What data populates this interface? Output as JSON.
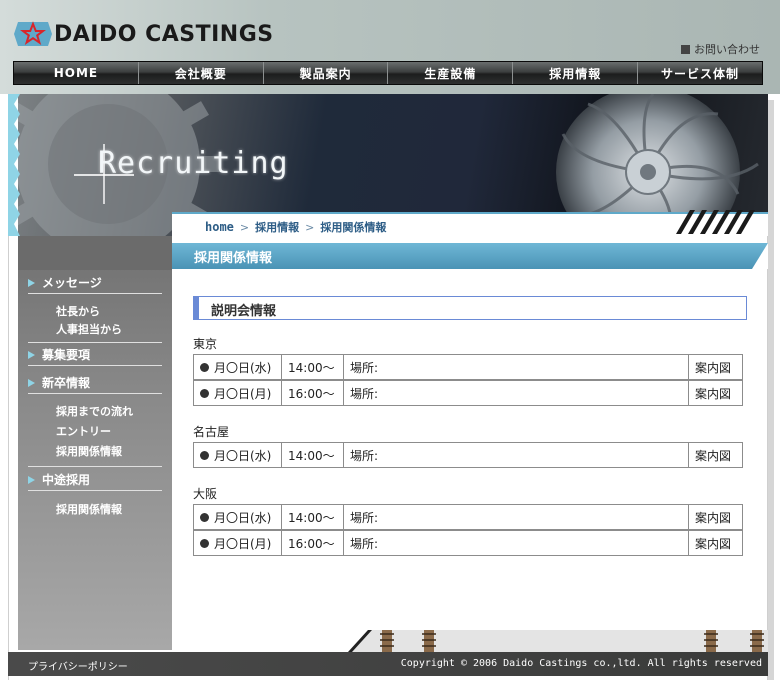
{
  "brand": {
    "name": "DAIDO CASTINGS"
  },
  "header": {
    "contact_label": "お問い合わせ"
  },
  "nav": [
    "HOME",
    "会社概要",
    "製品案内",
    "生産設備",
    "採用情報",
    "サービス体制"
  ],
  "hero": {
    "title": "Recruiting"
  },
  "breadcrumb": {
    "home": "home",
    "level1": "採用情報",
    "level2": "採用関係情報",
    "sep": ">"
  },
  "sidebar": {
    "sec1": "メッセージ",
    "sec1_items": [
      "社長から",
      "人事担当から"
    ],
    "sec2": "募集要項",
    "sec3": "新卒情報",
    "sec3_items": [
      "採用までの流れ",
      "エントリー",
      "採用関係情報"
    ],
    "sec4": "中途採用",
    "sec4_items": [
      "採用関係情報"
    ]
  },
  "page": {
    "title": "採用関係情報",
    "section": "説明会情報"
  },
  "regions": [
    {
      "name": "東京",
      "rows": [
        {
          "date": "月〇日(水)",
          "time": "14:00〜",
          "place": "場所:",
          "map": "案内図"
        },
        {
          "date": "月〇日(月)",
          "time": "16:00〜",
          "place": "場所:",
          "map": "案内図"
        }
      ]
    },
    {
      "name": "名古屋",
      "rows": [
        {
          "date": "月〇日(水)",
          "time": "14:00〜",
          "place": "場所:",
          "map": "案内図"
        }
      ]
    },
    {
      "name": "大阪",
      "rows": [
        {
          "date": "月〇日(水)",
          "time": "14:00〜",
          "place": "場所:",
          "map": "案内図"
        },
        {
          "date": "月〇日(月)",
          "time": "16:00〜",
          "place": "場所:",
          "map": "案内図"
        }
      ]
    }
  ],
  "footer": {
    "privacy": "プライバシーポリシー",
    "copyright": "Copyright ©  2006 Daido Castings co.,ltd. All rights reserved"
  },
  "colors": {
    "accent": "#4a93b5",
    "heading_border": "#6a8ad6",
    "sidebar": "#8a8a8a",
    "nav": "#2a2a2a"
  }
}
